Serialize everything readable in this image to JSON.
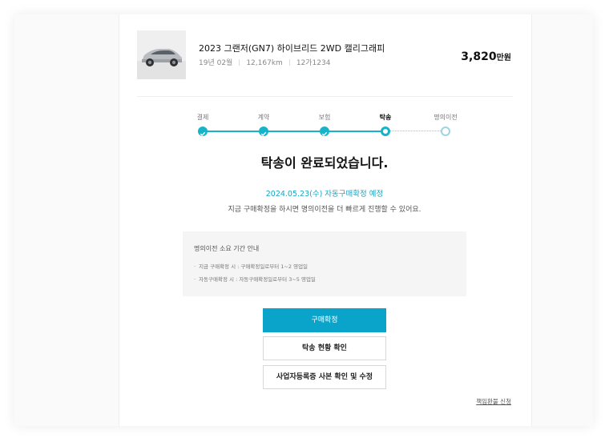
{
  "car": {
    "name": "2023 그랜저(GN7) 하이브리드 2WD 캘리그래피",
    "year_month": "19년 02월",
    "mileage": "12,167km",
    "plate": "12가1234",
    "price_value": "3,820",
    "price_unit": "만원",
    "image_icon": "car-photo"
  },
  "steps": [
    {
      "label": "결제",
      "state": "done"
    },
    {
      "label": "계약",
      "state": "done"
    },
    {
      "label": "보험",
      "state": "done"
    },
    {
      "label": "탁송",
      "state": "current"
    },
    {
      "label": "명의이전",
      "state": "pending"
    }
  ],
  "status": {
    "title": "탁송이 완료되었습니다.",
    "date_line": "2024.05.23(수) 자동구매확정 예정",
    "description": "지금 구매확정을 하시면 명의이전을 더 빠르게 진행할 수 있어요."
  },
  "info": {
    "title": "명의이전 소요 기간 안내",
    "items": [
      "지금 구매확정 시 : 구매확정일로부터 1~2 영업일",
      "자동구매확정 시 : 자동구매확정일로부터 3~5 영업일"
    ]
  },
  "buttons": {
    "confirm": "구매확정",
    "delivery_status": "탁송 현황 확인",
    "business_cert": "사업자등록증 사본 확인 및 수정"
  },
  "refund_link": "책임환불 신청",
  "colors": {
    "accent": "#16b3c9",
    "primary_button": "#0aa3c9",
    "pending_step": "#9fd3e3"
  }
}
